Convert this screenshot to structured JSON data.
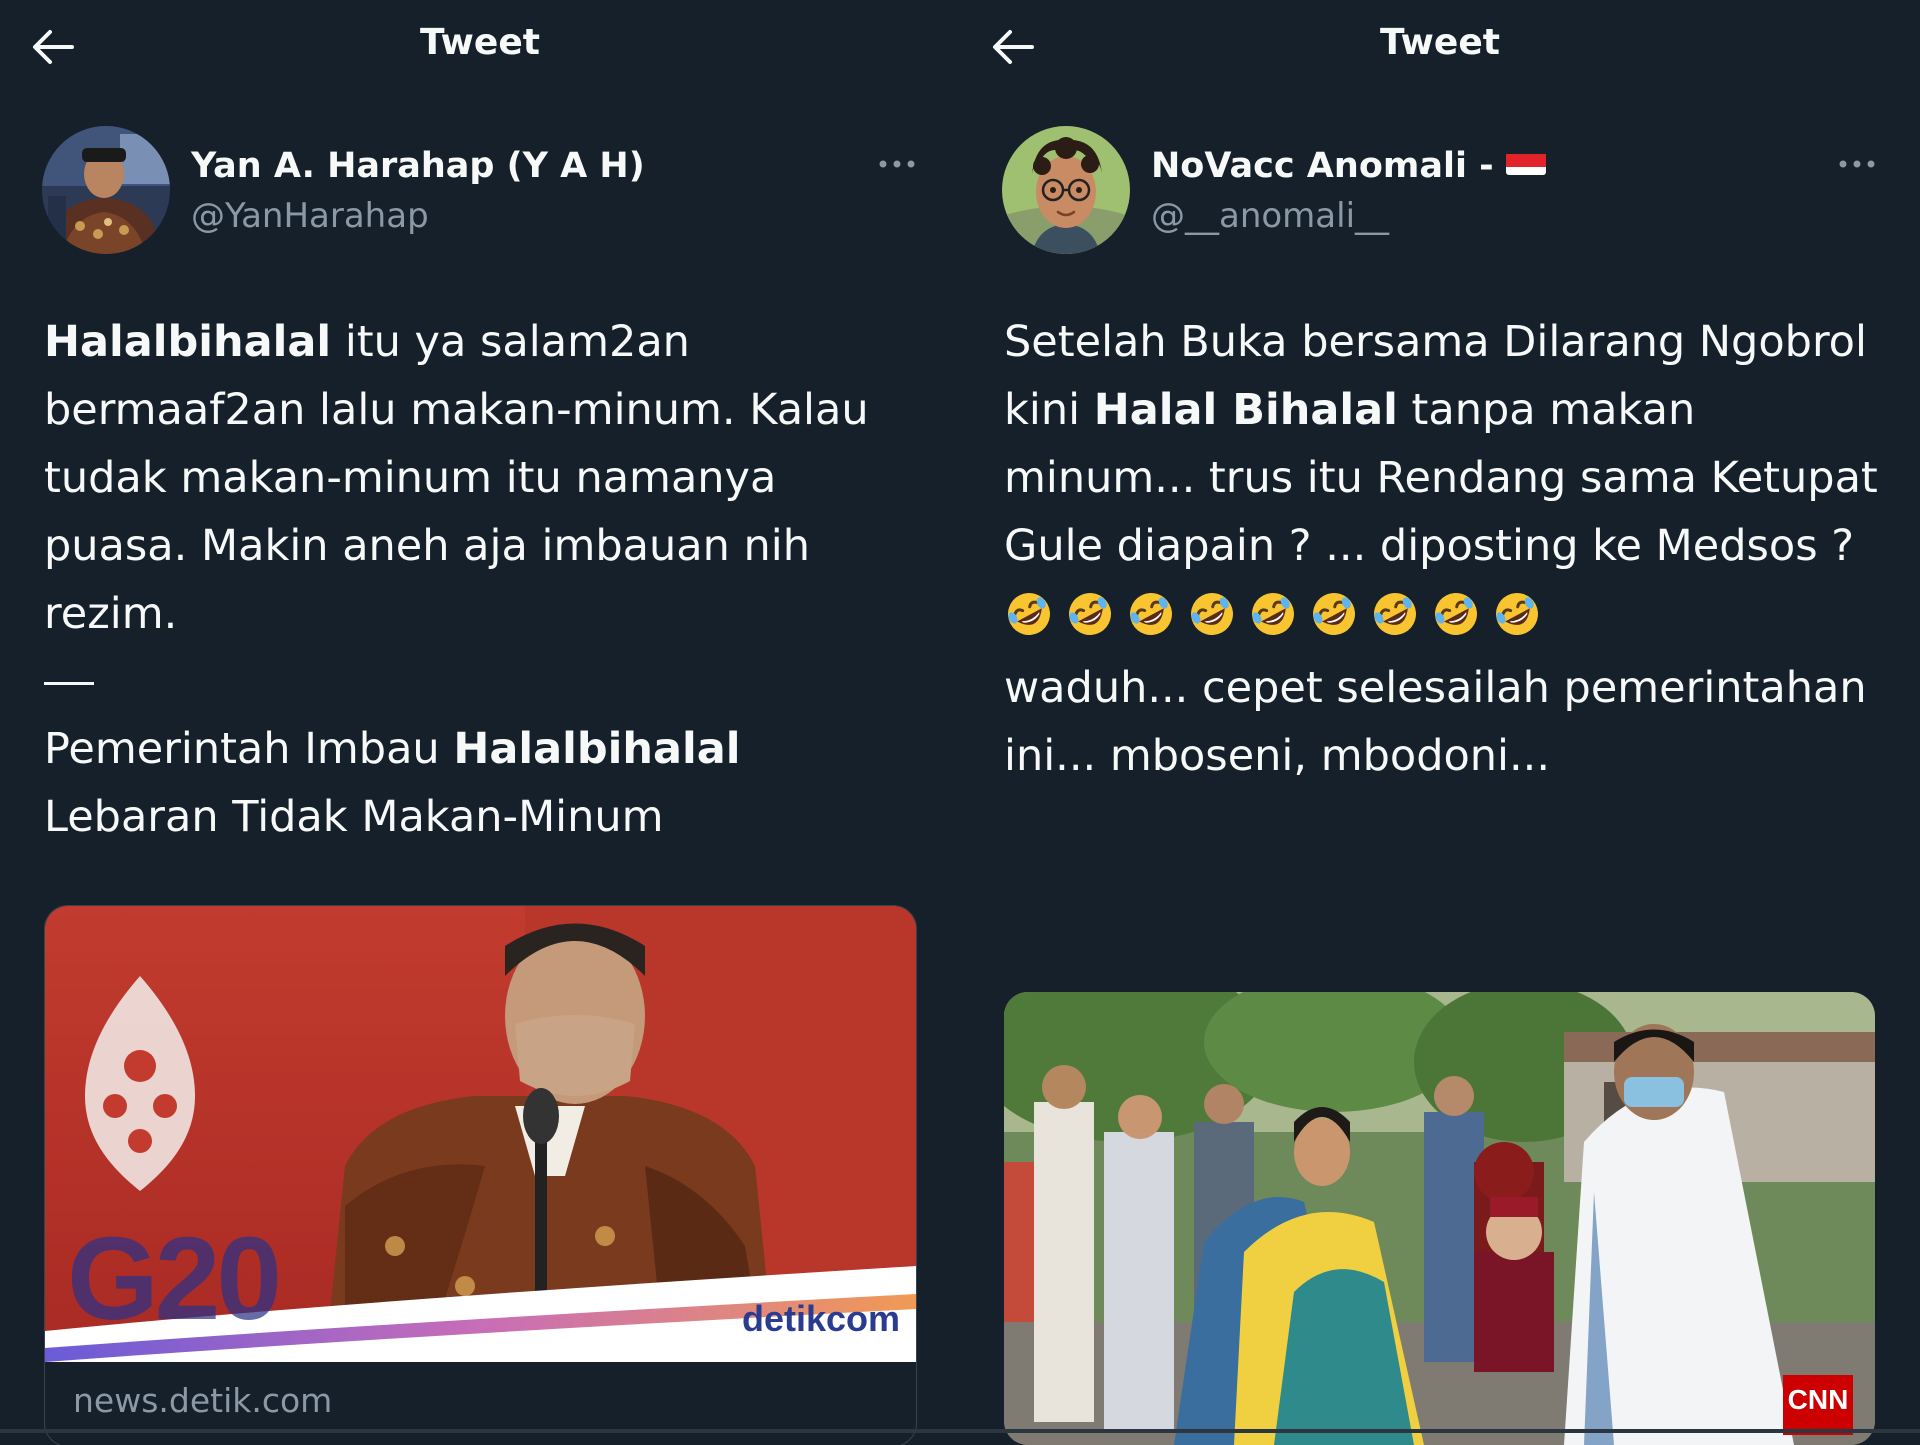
{
  "left_tweet": {
    "header_title": "Tweet",
    "author": {
      "name": "Yan A. Harahap (Y A H)",
      "handle": "@YanHarahap"
    },
    "text": {
      "p1_bold": "Halalbihalal",
      "p1_rest": " itu ya salam2an bermaaf2an lalu makan-minum. Kalau tudak makan-minum itu namanya puasa. Makin aneh aja imbauan nih rezim.",
      "p2_start": "Pemerintah Imbau ",
      "p2_bold": "Halalbihalal",
      "p2_end": " Lebaran Tidak Makan-Minum"
    },
    "card": {
      "image_text_g20": "G20",
      "image_logo": "detikcom",
      "domain": "news.detik.com"
    }
  },
  "right_tweet": {
    "header_title": "Tweet",
    "author": {
      "name": "NoVacc Anomali -",
      "flag_icon": "indonesia-flag-icon",
      "handle": "@__anomali__"
    },
    "text": {
      "p1_start": "Setelah Buka bersama Dilarang Ngobrol kini ",
      "p1_bold": "Halal Bihalal",
      "p1_end": " tanpa makan minum...  trus itu Rendang sama Ketupat Gule diapain ? ... diposting ke Medsos ?",
      "emoji_icon": "rolling-on-the-floor-laughing-icon",
      "emoji_count": 9,
      "p2": "waduh... cepet selesailah pemerintahan ini... mboseni, mbodoni..."
    },
    "media": {
      "watermark": "CNN"
    }
  },
  "colors": {
    "background": "#15202b",
    "text_primary": "#f7f9f9",
    "text_secondary": "#8b98a5",
    "border": "#38444d"
  }
}
